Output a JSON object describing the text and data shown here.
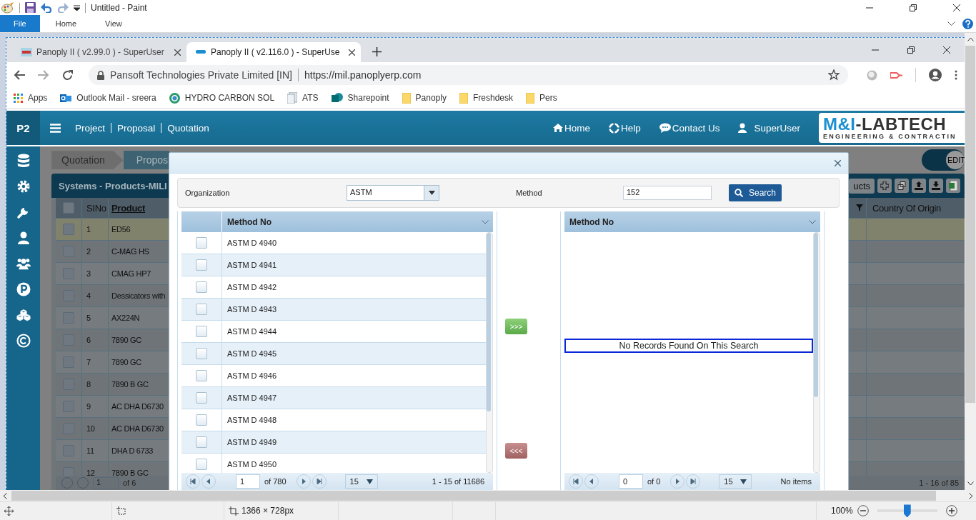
{
  "paint": {
    "title": "Untitled - Paint",
    "menu": [
      {
        "label": "File",
        "selected": true
      },
      {
        "label": "Home",
        "selected": false
      },
      {
        "label": "View",
        "selected": false
      }
    ],
    "status": {
      "size": "1366 × 728px",
      "zoom": "100%",
      "zoom_slider": {
        "level": 0.5
      }
    }
  },
  "browser": {
    "tabs": [
      {
        "title": "Panoply II ( v2.99.0 ) - SuperUser",
        "selected": false
      },
      {
        "title": "Panoply II ( v2.116.0 ) - SuperUse",
        "selected": true
      }
    ],
    "site": "Pansoft Technologies Private Limited [IN]",
    "url": "https://mil.panoplyerp.com",
    "bookmarks": [
      {
        "label": "Apps",
        "kind": "apps"
      },
      {
        "label": "Outlook Mail - sreera",
        "kind": "mail"
      },
      {
        "label": "HYDRO CARBON SOL",
        "kind": "ring"
      },
      {
        "label": "ATS",
        "kind": "doc"
      },
      {
        "label": "Sharepoint",
        "kind": "share"
      },
      {
        "label": "Panoply",
        "kind": "folder"
      },
      {
        "label": "Freshdesk",
        "kind": "folder"
      },
      {
        "label": "Pers",
        "kind": "folder"
      }
    ]
  },
  "app": {
    "brand": "P2",
    "nav": [
      "Project",
      "Proposal",
      "Quotation"
    ],
    "links": [
      {
        "label": "Home",
        "kind": "home"
      },
      {
        "label": "Help",
        "kind": "help"
      },
      {
        "label": "Contact Us",
        "kind": "chat"
      },
      {
        "label": "SuperUser",
        "kind": "user"
      }
    ],
    "logo_mark": "M&I",
    "logo_word": "-LABTECH",
    "logo_tagline": "ENGINEERING & CONTRACTIN",
    "sidebar": [
      {
        "kind": "database"
      },
      {
        "kind": "gear"
      },
      {
        "kind": "wrench"
      },
      {
        "kind": "user"
      },
      {
        "kind": "users"
      },
      {
        "kind": "p"
      },
      {
        "kind": "cubes"
      },
      {
        "kind": "copyright"
      }
    ],
    "edit_toggle": "EDIT",
    "background": {
      "breadcrumb": [
        "Quotation",
        "Propos"
      ],
      "panel_title": "Systems - Products-MILI",
      "toolbar_button": "ucts",
      "columns": [
        "SINo",
        "Product",
        "Country Of Origin"
      ],
      "all_checked": false,
      "rows": [
        {
          "no": "1",
          "product": "ED56",
          "selected": true
        },
        {
          "no": "2",
          "product": "C-MAG HS",
          "selected": false
        },
        {
          "no": "3",
          "product": "CMAG HP7",
          "selected": false
        },
        {
          "no": "4",
          "product": "Dessicators with",
          "selected": false
        },
        {
          "no": "5",
          "product": "AX224N",
          "selected": false
        },
        {
          "no": "6",
          "product": "7890 GC",
          "selected": false
        },
        {
          "no": "7",
          "product": "7890 GC",
          "selected": false
        },
        {
          "no": "8",
          "product": "7890 B GC",
          "selected": false
        },
        {
          "no": "9",
          "product": "AC DHA D6730",
          "selected": false
        },
        {
          "no": "10",
          "product": "AC DHA D6730",
          "selected": false
        },
        {
          "no": "11",
          "product": "DHA D 6733",
          "selected": false
        },
        {
          "no": "12",
          "product": "7890 B GC",
          "selected": false
        }
      ],
      "pager": {
        "page": "1",
        "of": "of 6",
        "range": "1 - 16 of 85"
      }
    }
  },
  "modal": {
    "organization_label": "Organization",
    "organization": "ASTM",
    "method_label": "Method",
    "method": "152",
    "search_button": "Search",
    "left_grid": {
      "header": "Method No",
      "rows": [
        {
          "method": "ASTM D 4940",
          "checked": false
        },
        {
          "method": "ASTM D 4941",
          "checked": false
        },
        {
          "method": "ASTM D 4942",
          "checked": false
        },
        {
          "method": "ASTM D 4943",
          "checked": false
        },
        {
          "method": "ASTM D 4944",
          "checked": false
        },
        {
          "method": "ASTM D 4945",
          "checked": false
        },
        {
          "method": "ASTM D 4946",
          "checked": false
        },
        {
          "method": "ASTM D 4947",
          "checked": false
        },
        {
          "method": "ASTM D 4948",
          "checked": false
        },
        {
          "method": "ASTM D 4949",
          "checked": false
        },
        {
          "method": "ASTM D 4950",
          "checked": false
        }
      ],
      "pager": {
        "page": "1",
        "of": "of 780",
        "size": "15",
        "range": "1 - 15 of 11686"
      }
    },
    "add_button": ">>>",
    "remove_button": "<<<",
    "right_grid": {
      "header": "Method No",
      "empty_message": "No Records Found On This Search",
      "pager": {
        "page": "0",
        "of": "of 0",
        "size": "15",
        "range": "No items"
      }
    }
  }
}
